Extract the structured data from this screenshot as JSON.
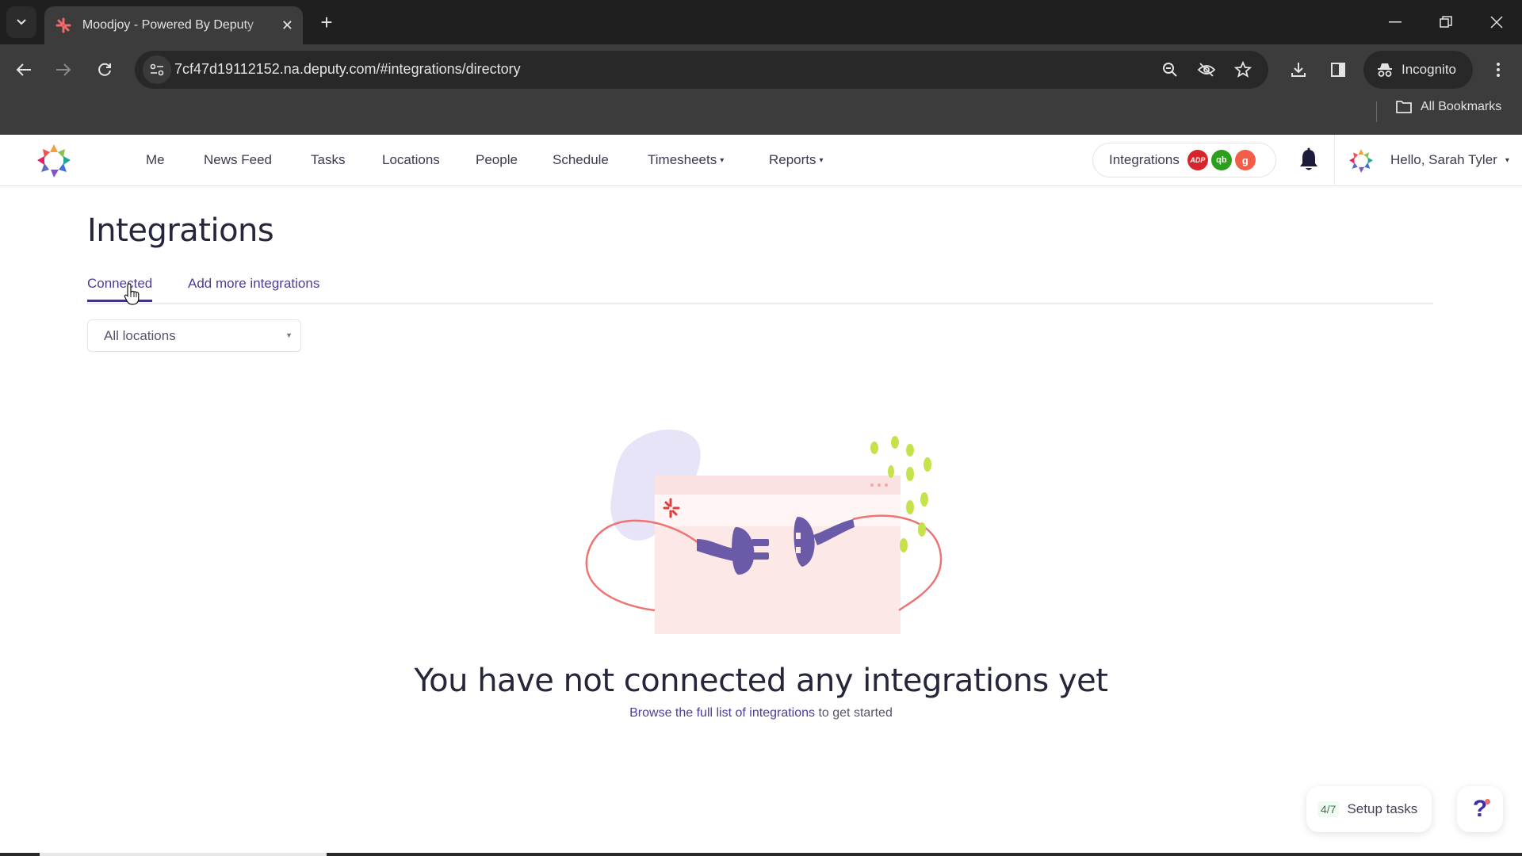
{
  "browser": {
    "tab_title": "Moodjoy - Powered By Deputy",
    "url": "7cf47d19112152.na.deputy.com/#integrations/directory",
    "incognito_label": "Incognito",
    "bookmarks_label": "All Bookmarks"
  },
  "nav": {
    "items": [
      {
        "label": "Me"
      },
      {
        "label": "News Feed"
      },
      {
        "label": "Tasks"
      },
      {
        "label": "Locations"
      },
      {
        "label": "People"
      },
      {
        "label": "Schedule"
      },
      {
        "label": "Timesheets",
        "caret": "▾"
      },
      {
        "label": "Reports",
        "caret": "▾"
      }
    ],
    "integrations_label": "Integrations",
    "integration_badges": [
      {
        "name": "ADP",
        "text": "ADP",
        "color": "#d7262b"
      },
      {
        "name": "QuickBooks",
        "text": "qb",
        "color": "#2ca01c"
      },
      {
        "name": "Gusto",
        "text": "g",
        "color": "#f45d48"
      }
    ],
    "user_greeting": "Hello, Sarah Tyler",
    "user_caret": "▾"
  },
  "page": {
    "title": "Integrations",
    "tabs": [
      {
        "label": "Connected",
        "active": true
      },
      {
        "label": "Add more integrations",
        "active": false
      }
    ],
    "location_select": {
      "value": "All locations"
    }
  },
  "empty_state": {
    "title": "You have not connected any integrations yet",
    "link_text": "Browse the full list of integrations",
    "suffix_text": " to get started"
  },
  "setup_tasks": {
    "count": "4/7",
    "label": "Setup tasks"
  },
  "help": {
    "label": "?"
  },
  "colors": {
    "brand_primary": "#3d3581",
    "link": "#4a3f97",
    "illustration_pink": "#f07878",
    "illustration_purple": "#6a5aa8",
    "illustration_green": "#c6e24a"
  }
}
